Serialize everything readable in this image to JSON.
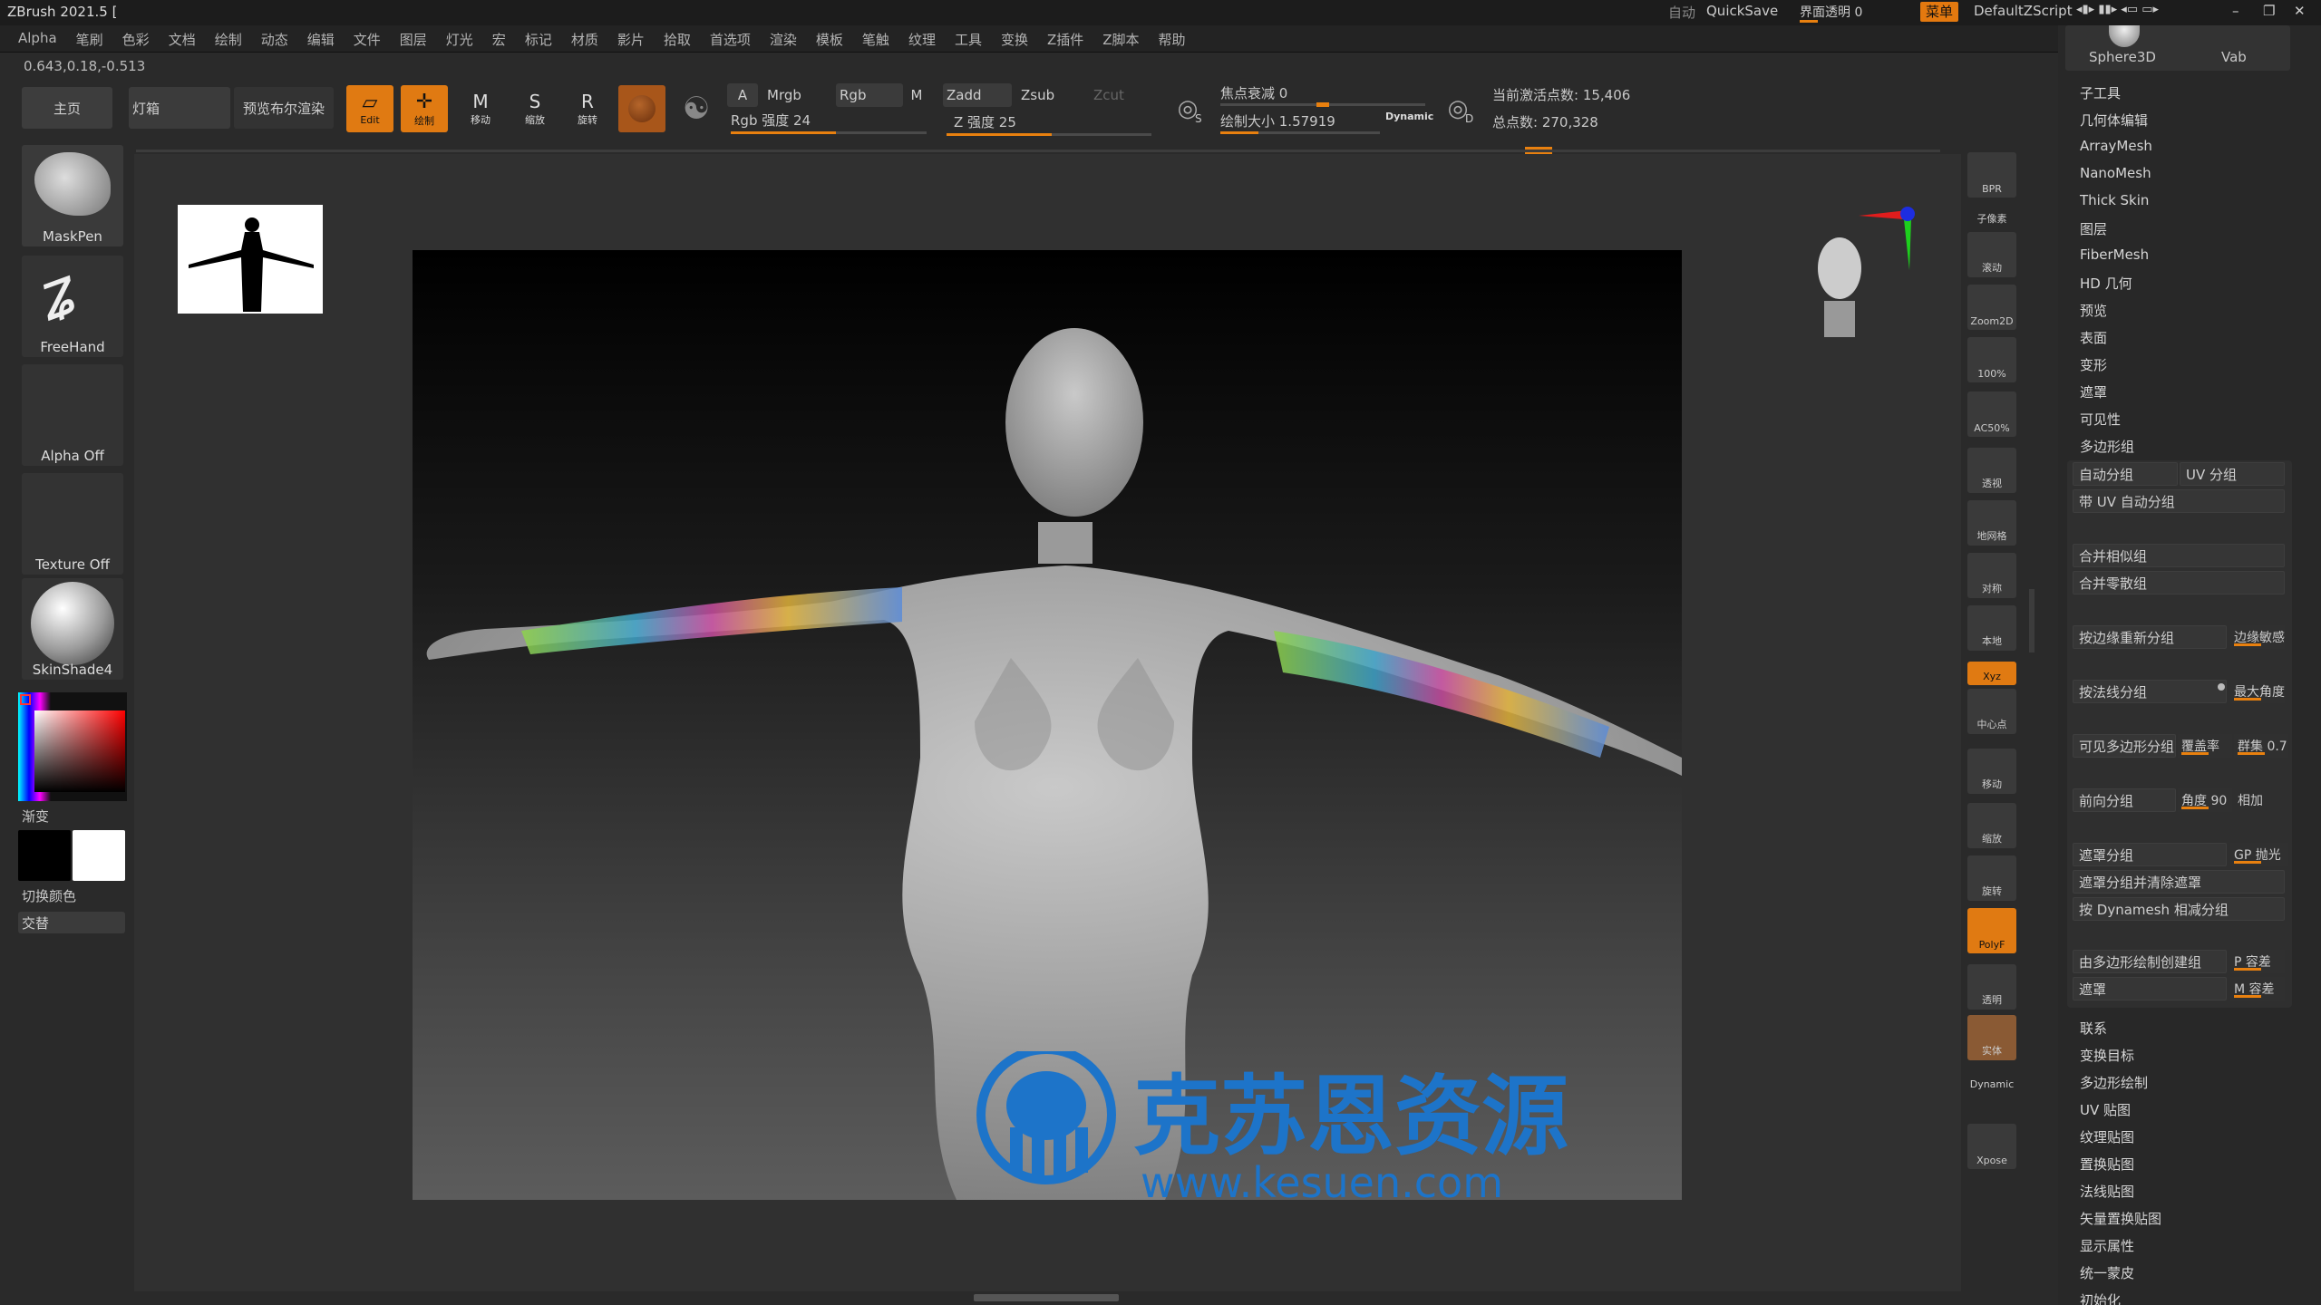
{
  "window": {
    "title": "ZBrush 2021.5 ["
  },
  "titlebar_right": {
    "auto_label": "自动",
    "quicksave": "QuickSave",
    "ui_transparency": "界面透明 0",
    "menu": "菜单",
    "script": "DefaultZScript"
  },
  "menu": [
    "Alpha",
    "笔刷",
    "色彩",
    "文档",
    "绘制",
    "动态",
    "编辑",
    "文件",
    "图层",
    "灯光",
    "宏",
    "标记",
    "材质",
    "影片",
    "拾取",
    "首选项",
    "渲染",
    "模板",
    "笔触",
    "纹理",
    "工具",
    "变换",
    "Z插件",
    "Z脚本",
    "帮助"
  ],
  "coords": "0.643,0.18,-0.513",
  "toolbar": {
    "home": "主页",
    "lightbox": "灯箱",
    "bpr_preview": "预览布尔渲染",
    "edit": "Edit",
    "draw": "绘制",
    "move": "移动",
    "scale": "缩放",
    "rotate": "旋转",
    "a_label": "A",
    "mrgb": "Mrgb",
    "rgb": "Rgb",
    "m": "M",
    "rgb_intensity": "Rgb 强度 24",
    "zadd": "Zadd",
    "zsub": "Zsub",
    "zcut": "Zcut",
    "z_intensity": "Z 强度 25",
    "s_label": "S",
    "focal_shift": "焦点衰减 0",
    "draw_size": "绘制大小 1.57919",
    "dynamic": "Dynamic",
    "d_label": "D",
    "active_points": "当前激活点数: 15,406",
    "total_points": "总点数: 270,328"
  },
  "left": {
    "brush": "MaskPen",
    "stroke": "FreeHand",
    "alpha": "Alpha Off",
    "texture": "Texture Off",
    "material": "SkinShade4",
    "gradient": "渐变",
    "switch_color": "切换颜色",
    "alternate": "交替"
  },
  "shelf": [
    "BPR",
    "子像素",
    "滚动",
    "Zoom2D",
    "100%",
    "AC50%",
    "透视",
    "地网格",
    "对称",
    "本地",
    "Xyz",
    "中心点",
    "移动",
    "缩放",
    "旋转",
    "PolyF",
    "透明",
    "实体",
    "Dynamic",
    "Xpose"
  ],
  "right_top": {
    "sphere": "Sphere3D",
    "vab": "Vab"
  },
  "right_menu": [
    "子工具",
    "几何体编辑",
    "ArrayMesh",
    "NanoMesh",
    "Thick Skin",
    "图层",
    "FiberMesh",
    "HD 几何",
    "预览",
    "表面",
    "变形",
    "遮罩",
    "可见性",
    "多边形组"
  ],
  "polygroups": {
    "auto_group": "自动分组",
    "uv_group": "UV 分组",
    "auto_with_uv": "带 UV 自动分组",
    "merge_similar": "合并相似组",
    "merge_stray": "合并零散组",
    "regroup_by_edge": "按边缘重新分组",
    "edge_sensitivity": "边缘敏感",
    "group_by_normals": "按法线分组",
    "max_angle": "最大角度",
    "group_visible": "可见多边形分组",
    "coverage": "覆盖率",
    "cluster": "群集 0.7",
    "front_group": "前向分组",
    "angle": "角度 90",
    "add": "相加",
    "group_masked": "遮罩分组",
    "gp_polish": "GP 抛光",
    "group_masked_clear": "遮罩分组并清除遮罩",
    "dynamesh_group": "按 Dynamesh 相减分组",
    "from_polypaint": "由多边形绘制创建组",
    "p_tolerance": "P 容差",
    "mask": "遮罩",
    "m_tolerance": "M 容差"
  },
  "right_menu_bottom": [
    "联系",
    "变换目标",
    "多边形绘制",
    "UV 贴图",
    "纹理贴图",
    "置换贴图",
    "法线贴图",
    "矢量置换贴图",
    "显示属性",
    "统一蒙皮",
    "初始化"
  ],
  "watermark": {
    "brand": "克苏恩资源",
    "url": "www.kesuen.com"
  },
  "colors": {
    "accent": "#e4790f",
    "watermark_blue": "#1d74c9"
  }
}
